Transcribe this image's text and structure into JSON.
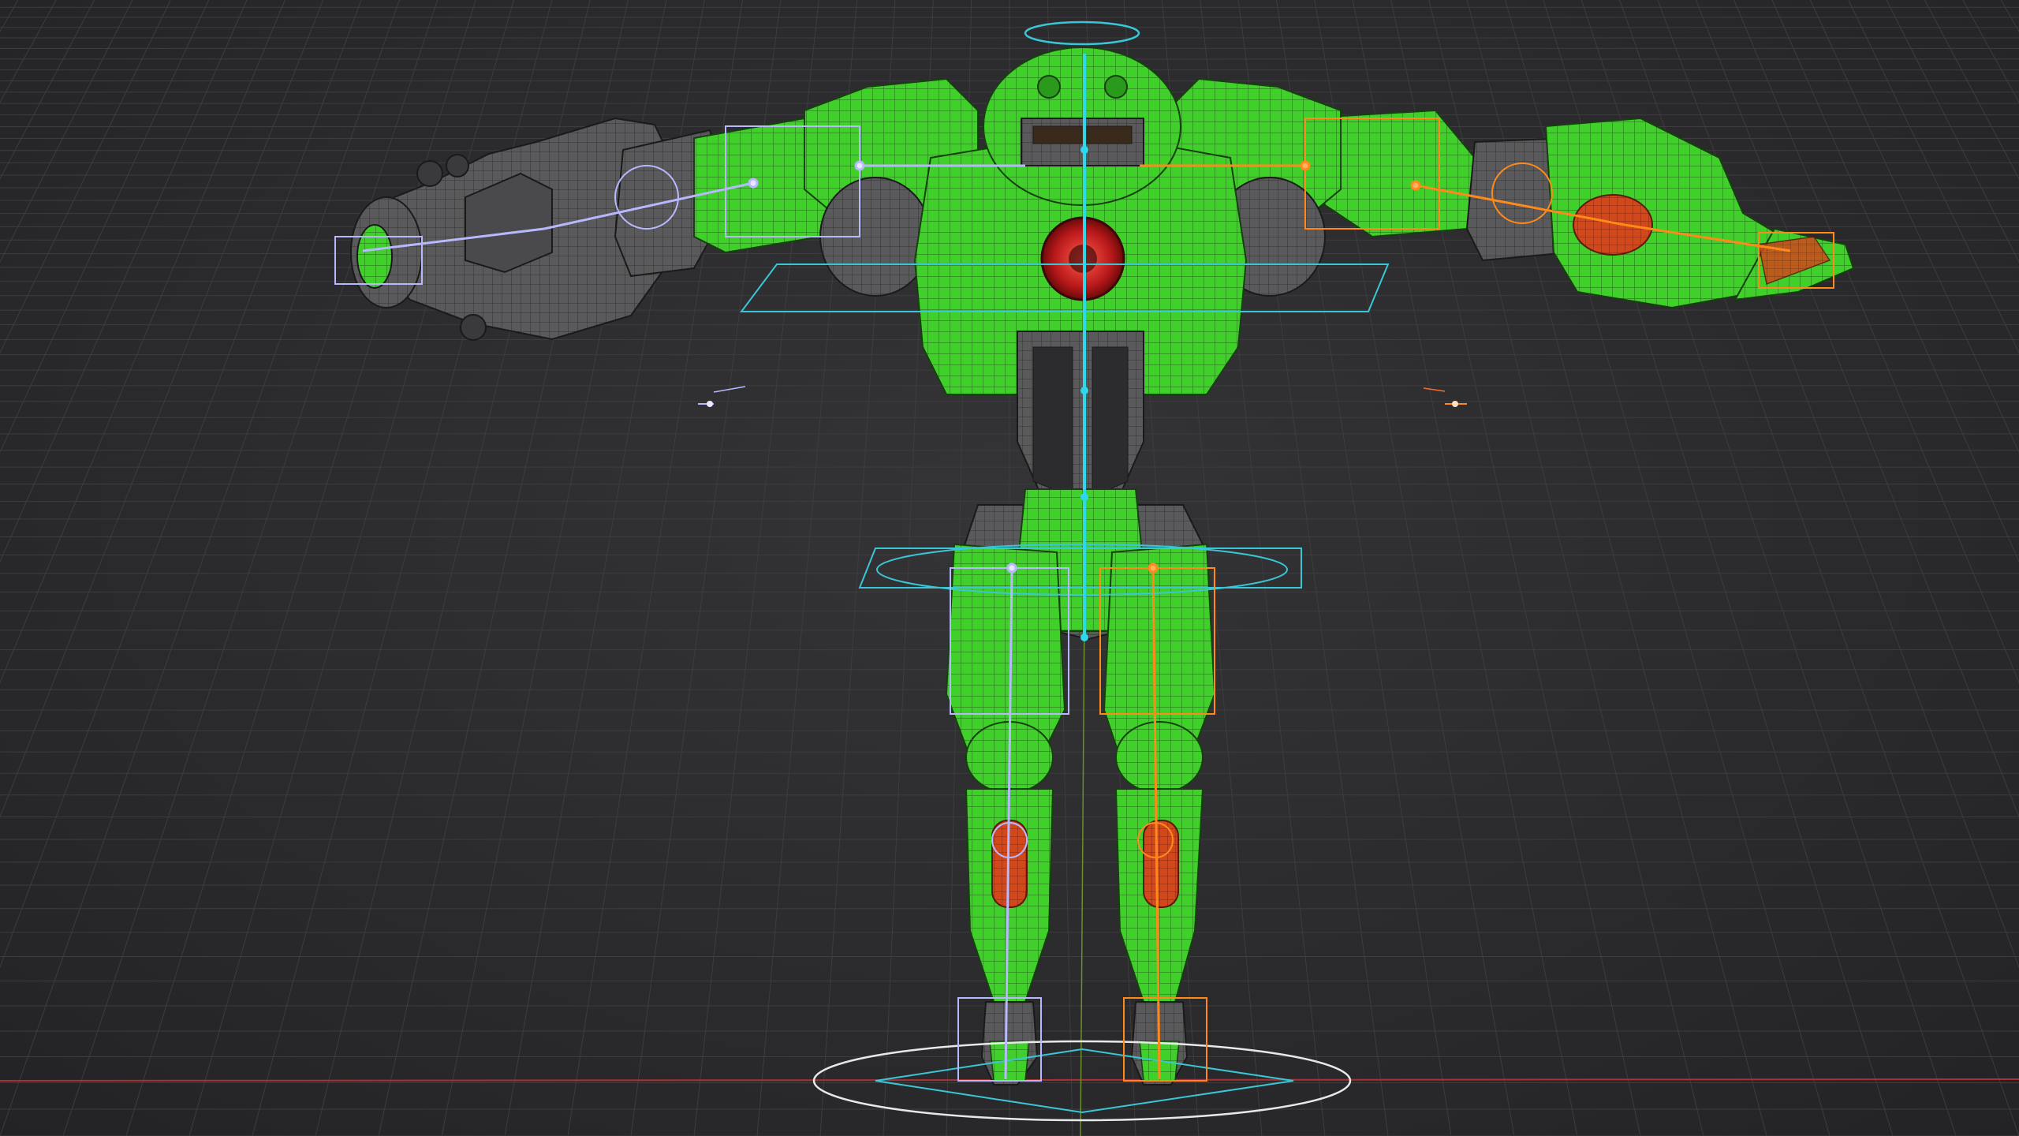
{
  "viewport": {
    "name": "3d-viewport",
    "background": "#2b2b2d",
    "grid_color": "#3d3d40",
    "axis_x_color": "#a83232",
    "axis_y_color": "#6b8f2a"
  },
  "model": {
    "name": "robot-mesh",
    "shading": "wireframe-on-solid",
    "body_color": "#3fd12a",
    "body_dark": "#2a9a1c",
    "metal_color": "#5a5a5c",
    "metal_dark": "#3a3a3c",
    "core_color": "#c0201a",
    "accent_color": "#d2481a",
    "wire_color": "#102a0a"
  },
  "rig": {
    "center_bone_color": "#2fd8e8",
    "left_side_color": "#b8b8ff",
    "right_side_color": "#ff8a1a",
    "control_color": "#39c6d6",
    "ground_control_color": "#e8e8e8"
  }
}
